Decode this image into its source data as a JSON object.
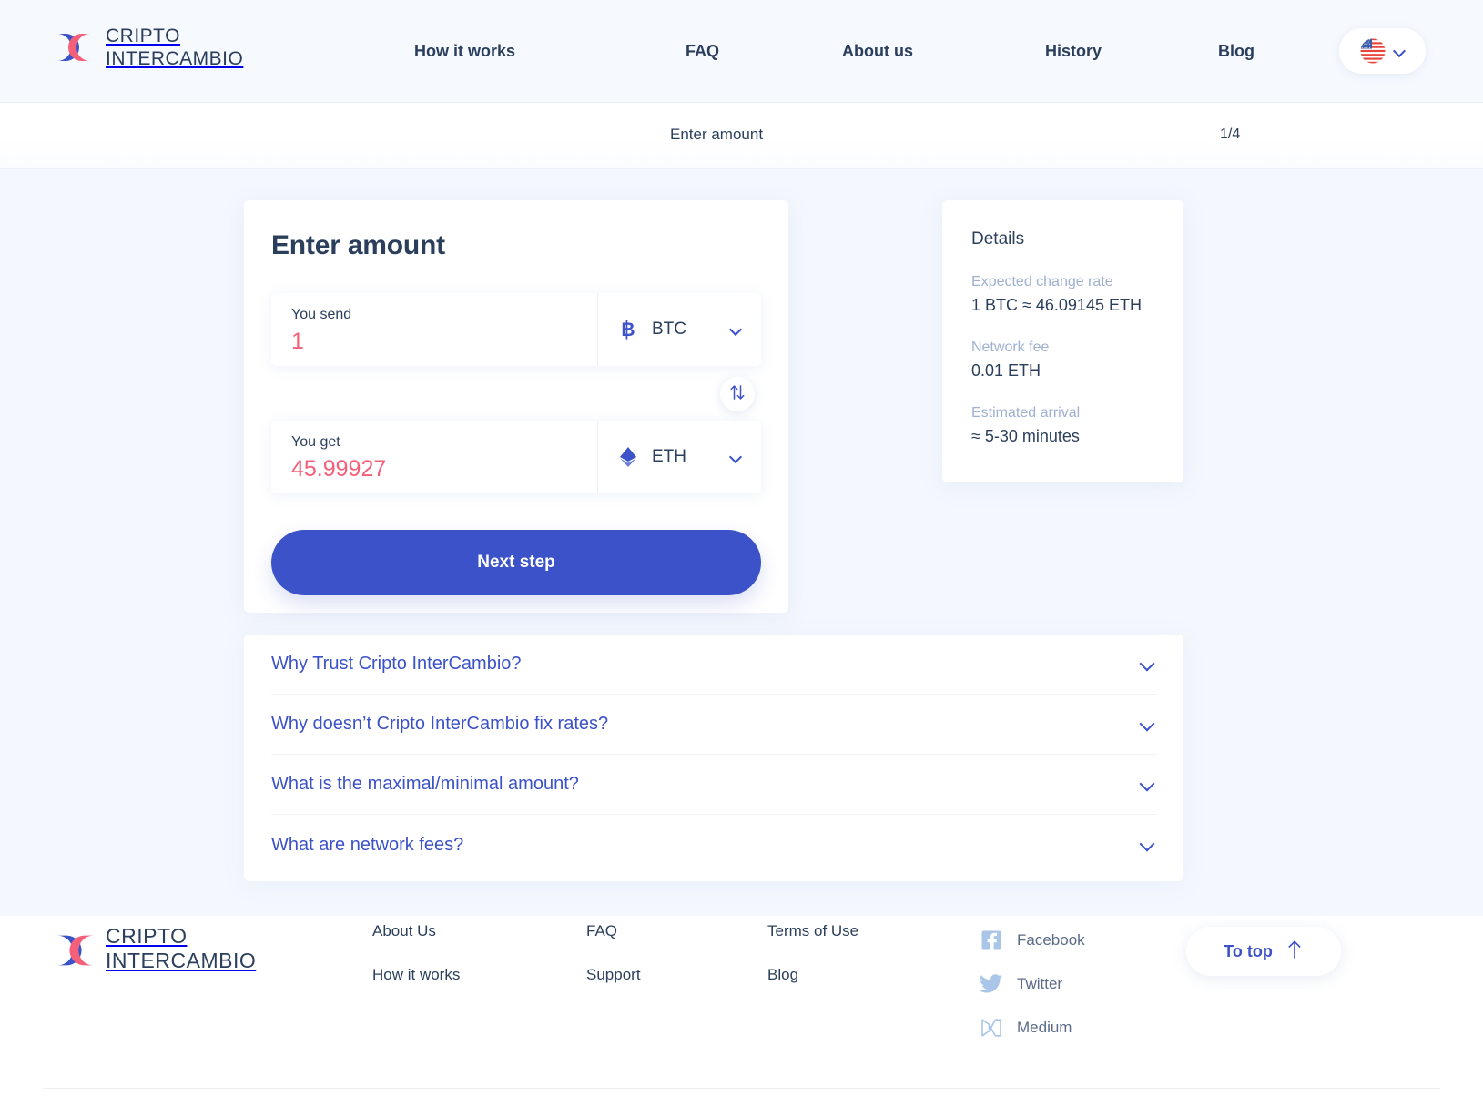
{
  "brand": {
    "name_line1": "CRIPTO",
    "name_line2": "INTERCAMBIO",
    "logo_blue": "#3b52c8",
    "logo_pink": "#f4607a"
  },
  "header": {
    "nav": [
      {
        "label": "How it works"
      },
      {
        "label": "FAQ"
      },
      {
        "label": "About us"
      },
      {
        "label": "History"
      },
      {
        "label": "Blog"
      }
    ],
    "language": {
      "icon": "us-flag-icon",
      "chevron": "chevron-down-icon"
    }
  },
  "stepbar": {
    "label": "Enter amount",
    "count": "1/4"
  },
  "exchange": {
    "title": "Enter amount",
    "send": {
      "label": "You send",
      "value": "1",
      "currency": "BTC",
      "currency_icon": "bitcoin-icon"
    },
    "get": {
      "label": "You get",
      "value": "45.99927",
      "currency": "ETH",
      "currency_icon": "ethereum-icon"
    },
    "swap_icon": "swap-arrows-icon",
    "next_button": "Next step",
    "accent_blue": "#3b52c8",
    "accent_pink": "#f4607a"
  },
  "details": {
    "title": "Details",
    "rows": [
      {
        "key": "Expected change rate",
        "value": "1 BTC ≈ 46.09145 ETH"
      },
      {
        "key": "Network fee",
        "value": "0.01 ETH"
      },
      {
        "key": "Estimated arrival",
        "value": "≈ 5-30 minutes"
      }
    ]
  },
  "faq": [
    {
      "question": "Why Trust Cripto InterCambio?"
    },
    {
      "question": "Why doesn’t Cripto InterCambio fix rates?"
    },
    {
      "question": "What is the maximal/minimal amount?"
    },
    {
      "question": "What are network fees?"
    }
  ],
  "footer": {
    "columns": [
      {
        "links": [
          "About Us",
          "How it works"
        ]
      },
      {
        "links": [
          "FAQ",
          "Support"
        ]
      },
      {
        "links": [
          "Terms of Use",
          "Blog"
        ]
      }
    ],
    "social": [
      {
        "name": "Facebook",
        "icon": "facebook-icon"
      },
      {
        "name": "Twitter",
        "icon": "twitter-icon"
      },
      {
        "name": "Medium",
        "icon": "medium-icon"
      }
    ],
    "to_top": {
      "label": "To top",
      "icon": "arrow-up-icon"
    }
  }
}
